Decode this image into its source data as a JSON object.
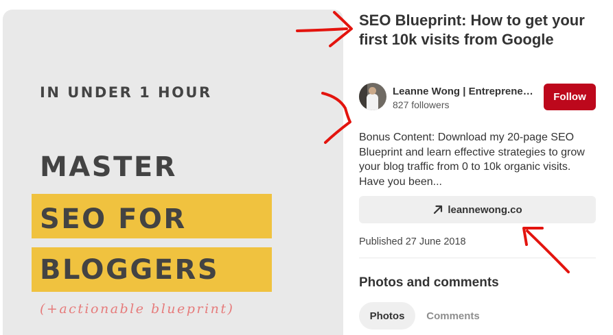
{
  "pin_image": {
    "eyebrow": "IN UNDER 1 HOUR",
    "line1": "MASTER",
    "line2": "SEO FOR",
    "line3": "BLOGGERS",
    "tagline": "(+actionable blueprint)"
  },
  "pin": {
    "title": "SEO Blueprint: How to get your first 10k visits from Google",
    "description": "Bonus Content: Download my 20-page SEO Blueprint and learn effective strategies to grow your blog traffic from 0 to 10k organic visits. Have you been...",
    "link_label": "leannewong.co",
    "link_icon": "arrow-up-right-icon",
    "published": "Published 27 June 2018"
  },
  "creator": {
    "name": "Leanne Wong | Entrepreneur...",
    "followers": "827 followers",
    "follow_label": "Follow"
  },
  "comments_section": {
    "title": "Photos and comments",
    "tabs": [
      {
        "label": "Photos",
        "active": true
      },
      {
        "label": "Comments",
        "active": false
      }
    ]
  },
  "colors": {
    "follow_red": "#bd081c",
    "highlight_yellow": "#f0c23f",
    "annotation_red": "#e3140e",
    "tagline_pink": "#e67b7b"
  }
}
